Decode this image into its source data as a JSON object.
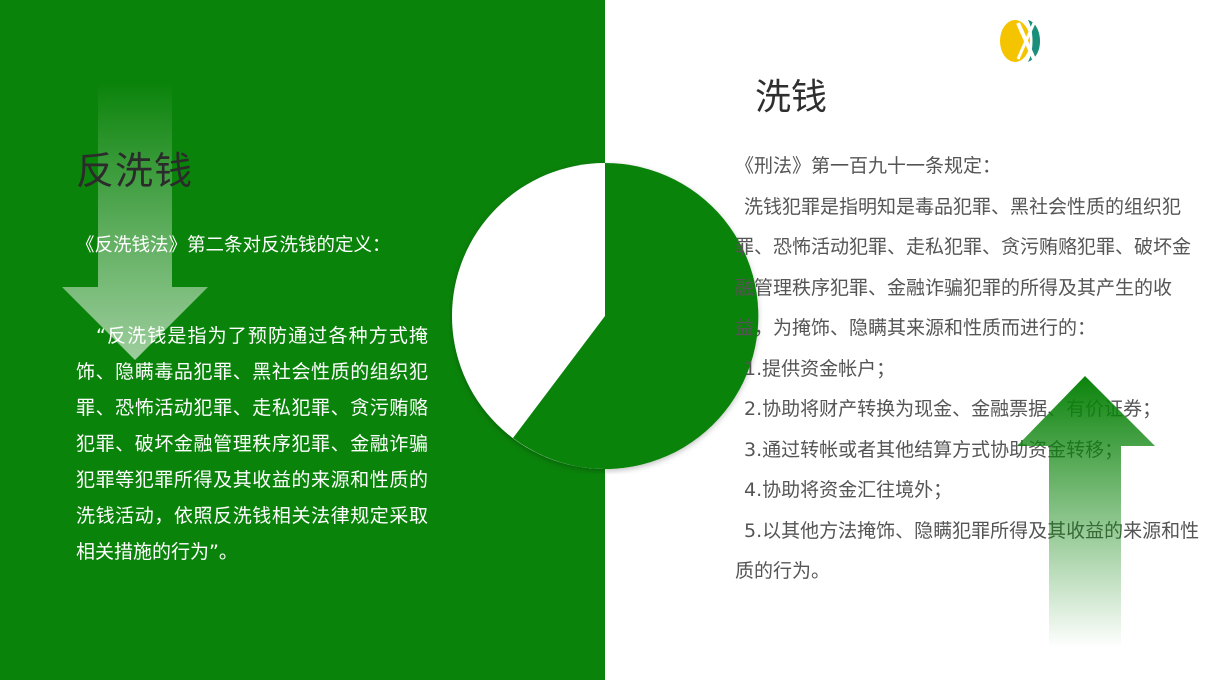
{
  "left": {
    "title": "反洗钱",
    "definition_intro": "《反洗钱法》第二条对反洗钱的定义：",
    "quote": "“反洗钱是指为了预防通过各种方式掩饰、隐瞒毒品犯罪、黑社会性质的组织犯罪、恐怖活动犯罪、走私犯罪、贪污贿赂犯罪、破坏金融管理秩序犯罪、金融诈骗犯罪等犯罪所得及其收益的来源和性质的洗钱活动，依照反洗钱相关法律规定采取相关措施的行为”。"
  },
  "right": {
    "title": "洗钱",
    "law_intro": "《刑法》第一百九十一条规定：",
    "definition": "洗钱犯罪是指明知是毒品犯罪、黑社会性质的组织犯罪、恐怖活动犯罪、走私犯罪、贪污贿赂犯罪、破坏金融管理秩序犯罪、金融诈骗犯罪的所得及其产生的收益，为掩饰、隐瞒其来源和性质而进行的：",
    "items": [
      "1.提供资金帐户；",
      "2.协助将财产转换为现金、金融票据、有价证券；",
      "3.通过转帐或者其他结算方式协助资金转移；",
      "4.协助将资金汇往境外；",
      "5.以其他方法掩饰、隐瞒犯罪所得及其收益的来源和性质的行为。"
    ]
  },
  "colors": {
    "primary_green": "#0a830a",
    "text_dark": "#2b2b2b",
    "text_gray": "#555555",
    "logo_yellow": "#f5c400",
    "logo_teal": "#1a8f7a"
  },
  "icons": [
    "down-arrow-icon",
    "up-arrow-icon",
    "logo-icon"
  ]
}
